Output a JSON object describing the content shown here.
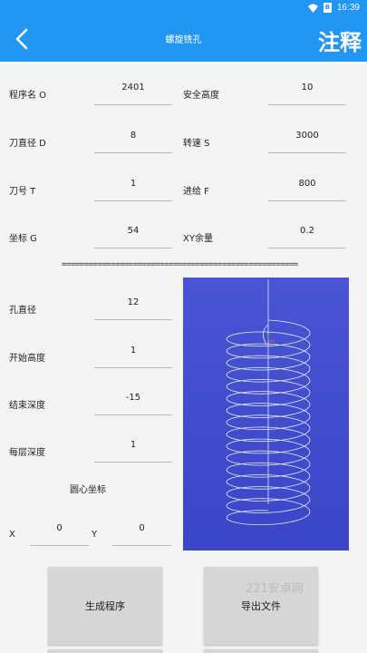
{
  "status": {
    "time": "16:39",
    "battery": "B"
  },
  "header": {
    "title": "螺旋铣孔",
    "action": "注释"
  },
  "params": {
    "program_label": "程序名 O",
    "program_value": "2401",
    "safe_height_label": "安全高度",
    "safe_height_value": "10",
    "tool_dia_label": "刀直径 D",
    "tool_dia_value": "8",
    "speed_label": "转速 S",
    "speed_value": "3000",
    "tool_no_label": "刀号 T",
    "tool_no_value": "1",
    "feed_label": "进给 F",
    "feed_value": "800",
    "coord_label": "坐标 G",
    "coord_value": "54",
    "xy_label": "XY余量",
    "xy_value": "0.2"
  },
  "divider": "=====================================================",
  "hole": {
    "hole_dia_label": "孔直径",
    "hole_dia_value": "12",
    "start_label": "开始高度",
    "start_value": "1",
    "end_label": "结束深度",
    "end_value": "-15",
    "step_label": "每层深度",
    "step_value": "1",
    "center_label": "圆心坐标",
    "x_label": "X",
    "x_value": "0",
    "y_label": "Y",
    "y_value": "0"
  },
  "buttons": {
    "generate": "生成程序",
    "export": "导出文件"
  },
  "watermark": "221安卓网",
  "colors": {
    "primary": "#2196f3",
    "preview_bg": "#4a55d4"
  }
}
